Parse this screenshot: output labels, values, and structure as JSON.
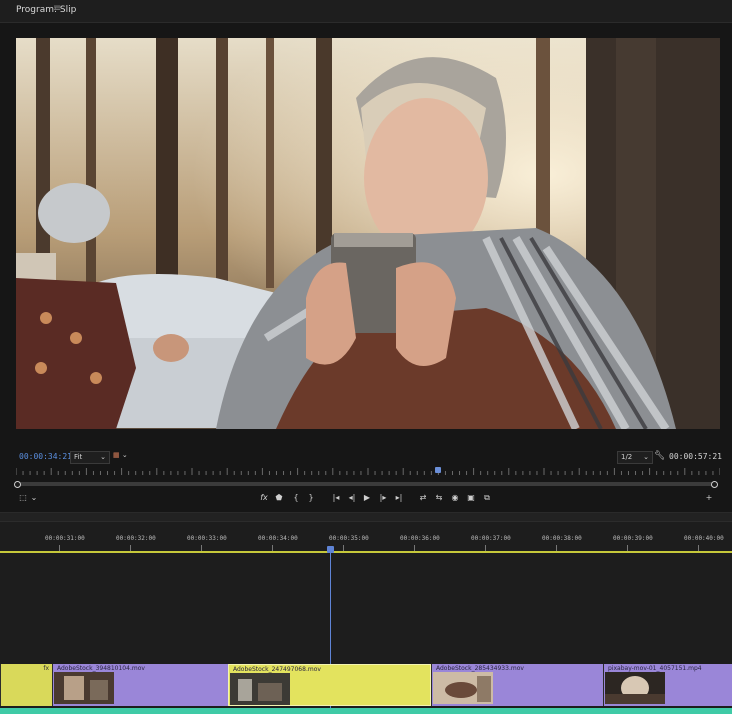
{
  "panel": {
    "title": "Program: Slip",
    "menu_icon": "hamburger-icon"
  },
  "monitor": {
    "current_timecode": "00:00:34:21",
    "duration_timecode": "00:00:57:21",
    "zoom": "Fit",
    "resolution": "1/2",
    "playhead_fraction": 0.6
  },
  "controls": {
    "icons": [
      "marker-icon",
      "mark-in-icon",
      "mark-out-icon",
      "go-to-in-icon",
      "step-back-icon",
      "play-icon",
      "step-forward-icon",
      "go-to-out-icon",
      "insert-icon",
      "overwrite-icon",
      "export-frame-icon",
      "comparison-view-icon",
      "vr-icon"
    ]
  },
  "timeline": {
    "ruler_labels": [
      "00:00:31:00",
      "00:00:32:00",
      "00:00:33:00",
      "00:00:34:00",
      "00:00:35:00",
      "00:00:36:00",
      "00:00:37:00",
      "00:00:38:00",
      "00:00:39:00",
      "00:00:40:00"
    ],
    "clips": [
      {
        "name": "",
        "fx": "fx"
      },
      {
        "name": "AdobeStock_394810104.mov",
        "fx": ""
      },
      {
        "name": "AdobeStock_247497068.mov",
        "fx": ""
      },
      {
        "name": "AdobeStock_285434933.mov",
        "fx": ""
      },
      {
        "name": "pixabay-mov-01_4057151.mp4",
        "fx": ""
      }
    ]
  },
  "colors": {
    "clip_purple": "#9a86d8",
    "clip_yellow": "#e3e35e",
    "playhead_blue": "#5f84d6",
    "audio_teal": "#3fcaa6"
  }
}
